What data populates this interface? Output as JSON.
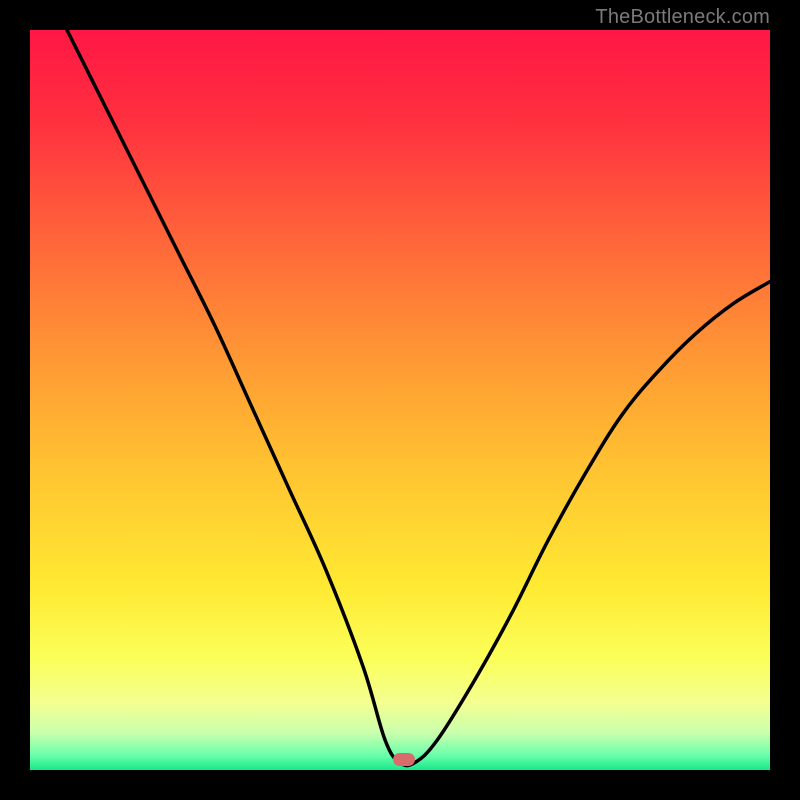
{
  "attribution": "TheBottleneck.com",
  "chart_data": {
    "type": "line",
    "title": "",
    "xlabel": "",
    "ylabel": "",
    "xlim": [
      0,
      100
    ],
    "ylim": [
      0,
      100
    ],
    "legend": false,
    "grid": false,
    "series": [
      {
        "name": "bottleneck-curve",
        "x": [
          5,
          10,
          15,
          20,
          25,
          30,
          35,
          40,
          45,
          48,
          50,
          52,
          55,
          60,
          65,
          70,
          75,
          80,
          85,
          90,
          95,
          100
        ],
        "values": [
          100,
          90,
          80,
          70,
          60,
          49,
          38,
          27,
          14,
          4,
          1,
          1,
          4,
          12,
          21,
          31,
          40,
          48,
          54,
          59,
          63,
          66
        ]
      }
    ],
    "optimal_point": {
      "x": 50.5,
      "y": 1
    },
    "background_gradient": [
      {
        "offset": 0.0,
        "color": "#ff1745"
      },
      {
        "offset": 0.12,
        "color": "#ff2f3f"
      },
      {
        "offset": 0.28,
        "color": "#ff643a"
      },
      {
        "offset": 0.45,
        "color": "#ff9a34"
      },
      {
        "offset": 0.6,
        "color": "#ffc531"
      },
      {
        "offset": 0.75,
        "color": "#ffe932"
      },
      {
        "offset": 0.85,
        "color": "#fbff5a"
      },
      {
        "offset": 0.91,
        "color": "#f3ff91"
      },
      {
        "offset": 0.95,
        "color": "#c9ffad"
      },
      {
        "offset": 0.98,
        "color": "#6bffab"
      },
      {
        "offset": 1.0,
        "color": "#18e889"
      }
    ],
    "marker_style": {
      "color": "#d96b6b",
      "width_pct": 3.0,
      "height_pct": 1.8,
      "y_center_pct": 1.4
    }
  }
}
